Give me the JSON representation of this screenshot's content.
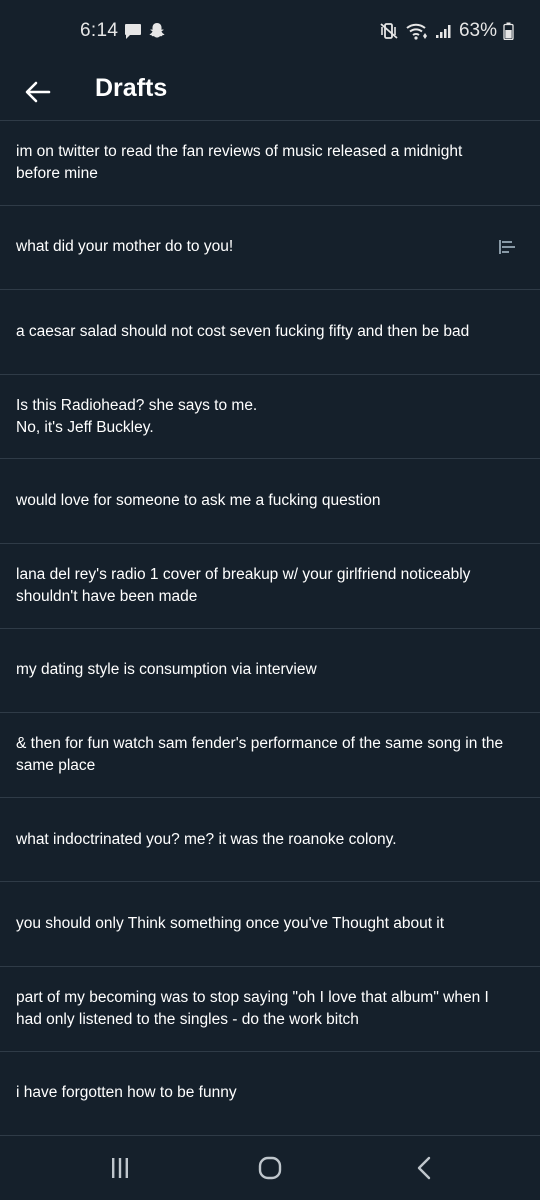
{
  "status_bar": {
    "time": "6:14",
    "battery": "63%"
  },
  "header": {
    "title": "Drafts"
  },
  "drafts": [
    {
      "text": "im on twitter to read the fan reviews of music released a midnight before mine"
    },
    {
      "text": "what did your mother do to you!"
    },
    {
      "text": "a caesar salad should not cost seven fucking fifty and then be bad"
    },
    {
      "text": "Is this Radiohead? she says to me.\nNo, it's Jeff Buckley."
    },
    {
      "text": "would love for someone to ask me a fucking question"
    },
    {
      "text": "lana del rey's radio 1 cover of breakup w/ your girlfriend noticeably shouldn't have been made"
    },
    {
      "text": "my dating style is consumption via interview"
    },
    {
      "text": "& then for fun watch sam fender's performance of the same song in the same place"
    },
    {
      "text": "what indoctrinated you? me? it was the roanoke colony."
    },
    {
      "text": "you should only Think something once you've Thought about it"
    },
    {
      "text": "part of my becoming was to stop saying \"oh I love that album\" when I had only listened to the singles - do the work bitch"
    },
    {
      "text": "i have forgotten how to be funny"
    }
  ],
  "icons": {
    "back": "arrow-left-icon",
    "thread": "thread-icon",
    "nav_recents": "recents-icon",
    "nav_home": "home-icon",
    "nav_back": "chevron-left-icon"
  },
  "colors": {
    "background": "#15202b",
    "divider": "#2f3b47",
    "text": "#ffffff",
    "muted": "#8899a6"
  }
}
